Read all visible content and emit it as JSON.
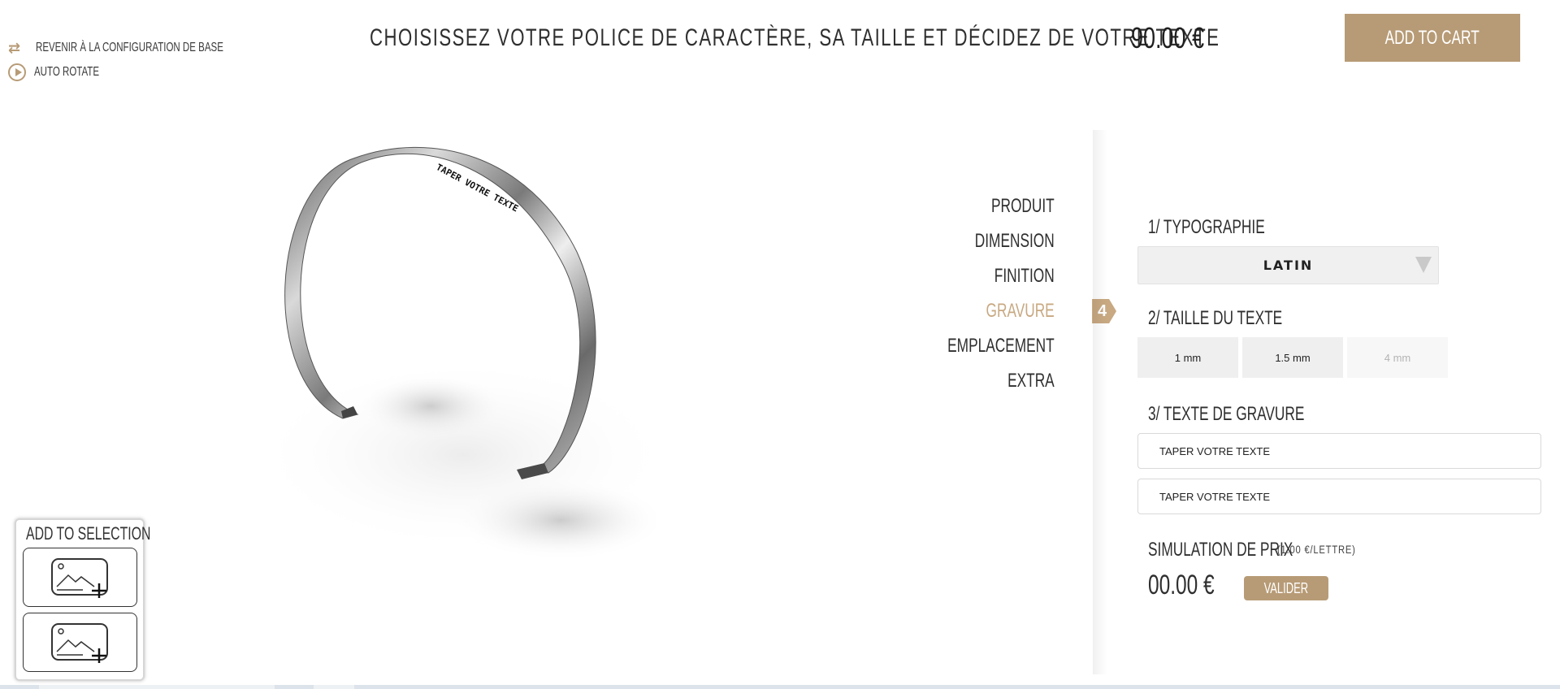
{
  "top_links": {
    "reset_label": "Revenir à la configuration de base",
    "rotate_label": "Auto rotate"
  },
  "header": {
    "title": "Choisissez votre police de caractère, sa taille et décidez de votre texte",
    "price": "90.00 €",
    "add_to_cart": "Add to cart"
  },
  "viewer": {
    "engraving_text": "TAPER VOTRE TEXTE"
  },
  "steps": {
    "items": [
      "Produit",
      "Dimension",
      "Finition",
      "Gravure",
      "Emplacement",
      "Extra"
    ],
    "active_number": "4"
  },
  "panel": {
    "typography_title": "1/ Typographie",
    "typography_value": "LATIN",
    "size_title": "2/ Taille du texte",
    "sizes": [
      "1 mm",
      "1.5 mm",
      "4 mm"
    ],
    "engraving_title": "3/ Texte de gravure",
    "text_line_1": "TAPER VOTRE TEXTE",
    "text_line_2": "TAPER VOTRE TEXTE",
    "simulation_title": "Simulation de prix",
    "simulation_unit": "(1.00 €/lettre)",
    "simulation_value": "00.00 €",
    "validate": "Valider"
  },
  "selection": {
    "title": "Add to selection"
  },
  "colors": {
    "accent": "#b79b76",
    "active_step": "#c8a982"
  }
}
